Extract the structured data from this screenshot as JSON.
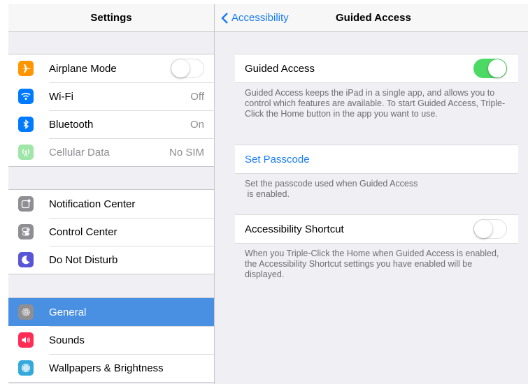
{
  "left_panel": {
    "title": "Settings",
    "groups": [
      {
        "items": [
          {
            "label": "Airplane Mode",
            "icon": "airplane-icon",
            "color": "#ff9500",
            "control": "toggle",
            "toggle_on": false
          },
          {
            "label": "Wi-Fi",
            "icon": "wifi-icon",
            "color": "#007aff",
            "value": "Off"
          },
          {
            "label": "Bluetooth",
            "icon": "bluetooth-icon",
            "color": "#007aff",
            "value": "On"
          },
          {
            "label": "Cellular Data",
            "icon": "cellular-icon",
            "color": "#4cd964",
            "value": "No SIM",
            "disabled": true
          }
        ]
      },
      {
        "items": [
          {
            "label": "Notification Center",
            "icon": "notification-center-icon",
            "color": "#8e8e93"
          },
          {
            "label": "Control Center",
            "icon": "control-center-icon",
            "color": "#8e8e93"
          },
          {
            "label": "Do Not Disturb",
            "icon": "moon-icon",
            "color": "#5856d6"
          }
        ]
      },
      {
        "items": [
          {
            "label": "General",
            "icon": "gear-icon",
            "color": "#8e8e93",
            "selected": true
          },
          {
            "label": "Sounds",
            "icon": "speaker-icon",
            "color": "#ff2d55"
          },
          {
            "label": "Wallpapers & Brightness",
            "icon": "flower-icon",
            "color": "#34aadc"
          }
        ]
      }
    ]
  },
  "right_panel": {
    "back_label": "Accessibility",
    "title": "Guided Access",
    "guided_access": {
      "label": "Guided Access",
      "toggle_on": true
    },
    "guided_access_footnote": "Guided Access keeps the iPad in a single app, and allows you to control which features are available. To start Guided Access, Triple-Click the Home button in the app you want to use.",
    "set_passcode": {
      "label": "Set Passcode"
    },
    "set_passcode_footnote_line1": "Set the passcode used when Guided Access",
    "set_passcode_footnote_line2": " is enabled.",
    "accessibility_shortcut": {
      "label": "Accessibility Shortcut",
      "toggle_on": false
    },
    "accessibility_shortcut_footnote": "When you Triple-Click the Home when Guided Access is enabled, the Accessibility Shortcut settings you have enabled will be displayed."
  },
  "colors": {
    "accent_blue": "#1a7cf5",
    "selection_blue": "#4a90e2",
    "toggle_green": "#4cd964",
    "background": "#efeff4"
  }
}
